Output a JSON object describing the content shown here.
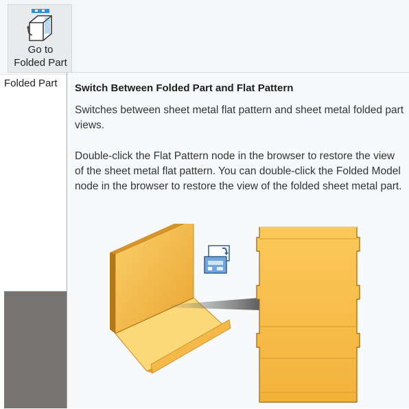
{
  "ribbon": {
    "button": {
      "label_line1": "Go to",
      "label_line2": "Folded Part",
      "icon": "go-to-folded-part-icon"
    },
    "panel_label": "Folded Part"
  },
  "tooltip": {
    "title": "Switch Between Folded Part and Flat Pattern",
    "paragraph1": "Switches between sheet metal flat pattern and sheet metal folded part views.",
    "paragraph2": "Double-click the Flat Pattern node in the browser to restore the view of the sheet metal flat pattern. You can double-click the Folded Model node in the browser to restore the view of the folded sheet metal part.",
    "illustration": {
      "left": "folded-sheet-metal-part",
      "arrow": "arrow-right",
      "badge": "flat-pattern-icon",
      "right": "flat-pattern-sheet"
    }
  },
  "colors": {
    "sheet_metal": "#f6b940",
    "sheet_metal_dark": "#c98b20",
    "viewport_bg": "#777371",
    "tooltip_bg": "#f8f9fa"
  }
}
